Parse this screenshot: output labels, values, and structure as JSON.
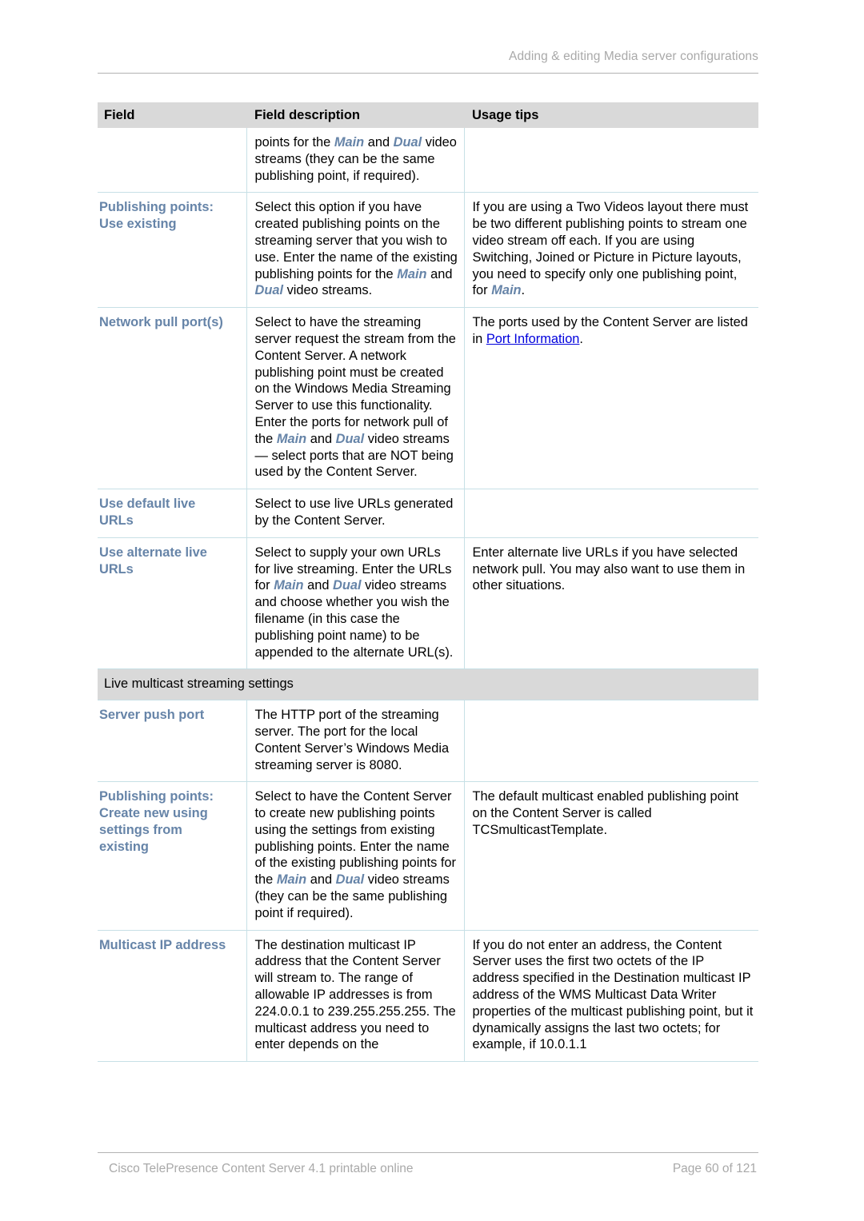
{
  "header": {
    "running_title": "Adding & editing Media server configurations"
  },
  "table": {
    "columns": [
      "Field",
      "Field description",
      "Usage tips"
    ],
    "rows": [
      {
        "type": "data",
        "continued": true,
        "field": "",
        "description_parts": [
          {
            "t": "points for the "
          },
          {
            "t": "Main",
            "em": true
          },
          {
            "t": " and "
          },
          {
            "t": "Dual",
            "em": true
          },
          {
            "t": " video streams (they can be the same publishing point, if required)."
          }
        ],
        "description_plain": "points for the Main and Dual video streams (they can be the same publishing point, if required).",
        "tips_plain": ""
      },
      {
        "type": "data",
        "field_lines": [
          "Publishing points:",
          "Use existing"
        ],
        "description_parts": [
          {
            "t": "Select this option if you have created publishing points on the streaming server that you wish to use. Enter the name of the existing publishing points for the "
          },
          {
            "t": "Main",
            "em": true
          },
          {
            "t": " and "
          },
          {
            "t": "Dual",
            "em": true
          },
          {
            "t": " video streams."
          }
        ],
        "description_plain": "Select this option if you have created publishing points on the streaming server that you wish to use. Enter the name of the existing publishing points for the Main and Dual video streams.",
        "tips_parts": [
          {
            "t": "If you are using a Two Videos layout there must be two different publishing points to stream one video stream off each. If you are using Switching, Joined or Picture in Picture layouts, you need to specify only one publishing point, for "
          },
          {
            "t": "Main",
            "em": true
          },
          {
            "t": "."
          }
        ],
        "tips_plain": "If you are using a Two Videos layout there must be two different publishing points to stream one video stream off each. If you are using Switching, Joined or Picture in Picture layouts, you need to specify only one publishing point, for Main."
      },
      {
        "type": "data",
        "field_lines": [
          "Network pull port(s)"
        ],
        "description_parts": [
          {
            "t": "Select to have the streaming server request the stream from the Content Server. A network publishing point must be created on the Windows Media Streaming Server to use this functionality. Enter the ports for network pull of the "
          },
          {
            "t": "Main",
            "em": true
          },
          {
            "t": " and "
          },
          {
            "t": "Dual",
            "em": true
          },
          {
            "t": " video streams — select ports that are NOT being used by the Content Server."
          }
        ],
        "description_plain": "Select to have the streaming server request the stream from the Content Server. A network publishing point must be created on the Windows Media Streaming Server to use this functionality. Enter the ports for network pull of the Main and Dual video streams — select ports that are NOT being used by the Content Server.",
        "tips_parts": [
          {
            "t": "The ports used by the Content Server are listed in "
          },
          {
            "t": "Port Information",
            "link": true
          },
          {
            "t": "."
          }
        ],
        "tips_plain": "The ports used by the Content Server are listed in Port Information."
      },
      {
        "type": "data",
        "field_lines": [
          "Use default live",
          "URLs"
        ],
        "description_parts": [
          {
            "t": "Select to use live URLs generated by the Content Server."
          }
        ],
        "description_plain": "Select to use live URLs generated by the Content Server.",
        "tips_plain": ""
      },
      {
        "type": "data",
        "field_lines": [
          "Use alternate live",
          "URLs"
        ],
        "description_parts": [
          {
            "t": "Select to supply your own URLs for live streaming. Enter the URLs for "
          },
          {
            "t": "Main",
            "em": true
          },
          {
            "t": " and "
          },
          {
            "t": "Dual",
            "em": true
          },
          {
            "t": " video streams and choose whether you wish the filename (in this case the publishing point name) to be appended to the alternate URL(s)."
          }
        ],
        "description_plain": "Select to supply your own URLs for live streaming. Enter the URLs for Main and Dual video streams and choose whether you wish the filename (in this case the publishing point name) to be appended to the alternate URL(s).",
        "tips_parts": [
          {
            "t": "Enter alternate live URLs if you have selected network pull. You may also want to use them in other situations."
          }
        ],
        "tips_plain": "Enter alternate live URLs if you have selected network pull. You may also want to use them in other situations."
      },
      {
        "type": "section",
        "label": "Live multicast streaming settings"
      },
      {
        "type": "data",
        "field_lines": [
          "Server push port"
        ],
        "description_parts": [
          {
            "t": "The HTTP port of the streaming server. The port for the local Content Server’s Windows Media streaming server is 8080."
          }
        ],
        "description_plain": "The HTTP port of the streaming server. The port for the local Content Server’s Windows Media streaming server is 8080.",
        "tips_plain": ""
      },
      {
        "type": "data",
        "field_lines": [
          "Publishing points:",
          "Create new using",
          "settings from",
          "existing"
        ],
        "description_parts": [
          {
            "t": "Select to have the Content Server to create new publishing points using the settings from existing publishing points. Enter the name of the existing publishing points for the "
          },
          {
            "t": "Main",
            "em": true
          },
          {
            "t": " and "
          },
          {
            "t": "Dual",
            "em": true
          },
          {
            "t": " video streams (they can be the same publishing point if required)."
          }
        ],
        "description_plain": "Select to have the Content Server to create new publishing points using the settings from existing publishing points. Enter the name of the existing publishing points for the Main and Dual video streams (they can be the same publishing point if required).",
        "tips_parts": [
          {
            "t": "The default multicast enabled publishing point on the Content Server is called TCSmulticastTemplate."
          }
        ],
        "tips_plain": "The default multicast enabled publishing point on the Content Server is called TCSmulticastTemplate."
      },
      {
        "type": "data",
        "field_lines": [
          "Multicast IP address"
        ],
        "description_parts": [
          {
            "t": "The destination multicast IP address that the Content Server will stream to. The range of allowable IP addresses is from 224.0.0.1 to 239.255.255.255. The multicast address you need to enter depends on the"
          }
        ],
        "description_plain": "The destination multicast IP address that the Content Server will stream to. The range of allowable IP addresses is from 224.0.0.1 to 239.255.255.255. The multicast address you need to enter depends on the",
        "tips_parts": [
          {
            "t": "If you do not enter an address, the Content Server uses the first two octets of the IP address specified in the Destination multicast IP address of the WMS Multicast Data Writer properties of the multicast publishing point, but it dynamically assigns the last two octets; for example, if 10.0.1.1"
          }
        ],
        "tips_plain": "If you do not enter an address, the Content Server uses the first two octets of the IP address specified in the Destination multicast IP address of the WMS Multicast Data Writer properties of the multicast publishing point, but it dynamically assigns the last two octets; for example, if 10.0.1.1"
      }
    ]
  },
  "footer": {
    "left": "Cisco TelePresence Content Server 4.1 printable online",
    "right": "Page 60 of 121"
  },
  "colors": {
    "header_band": "#d9d9d9",
    "field_label": "#6684a8",
    "emphasis": "#6684a8",
    "link": "#0000dd",
    "rule": "#c7e0e6",
    "muted_text": "#a9a9a9"
  }
}
